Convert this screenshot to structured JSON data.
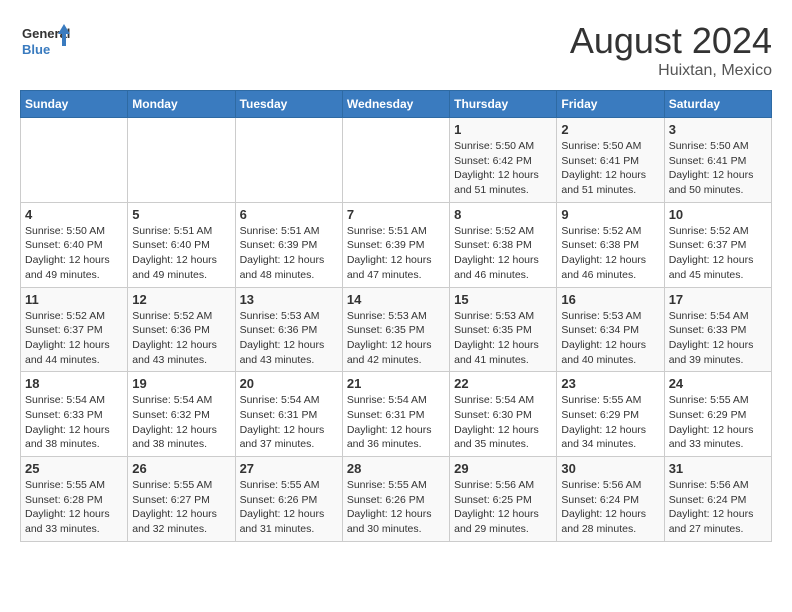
{
  "logo": {
    "line1": "General",
    "line2": "Blue"
  },
  "title": "August 2024",
  "subtitle": "Huixtan, Mexico",
  "days_header": [
    "Sunday",
    "Monday",
    "Tuesday",
    "Wednesday",
    "Thursday",
    "Friday",
    "Saturday"
  ],
  "weeks": [
    [
      {
        "num": "",
        "info": ""
      },
      {
        "num": "",
        "info": ""
      },
      {
        "num": "",
        "info": ""
      },
      {
        "num": "",
        "info": ""
      },
      {
        "num": "1",
        "info": "Sunrise: 5:50 AM\nSunset: 6:42 PM\nDaylight: 12 hours\nand 51 minutes."
      },
      {
        "num": "2",
        "info": "Sunrise: 5:50 AM\nSunset: 6:41 PM\nDaylight: 12 hours\nand 51 minutes."
      },
      {
        "num": "3",
        "info": "Sunrise: 5:50 AM\nSunset: 6:41 PM\nDaylight: 12 hours\nand 50 minutes."
      }
    ],
    [
      {
        "num": "4",
        "info": "Sunrise: 5:50 AM\nSunset: 6:40 PM\nDaylight: 12 hours\nand 49 minutes."
      },
      {
        "num": "5",
        "info": "Sunrise: 5:51 AM\nSunset: 6:40 PM\nDaylight: 12 hours\nand 49 minutes."
      },
      {
        "num": "6",
        "info": "Sunrise: 5:51 AM\nSunset: 6:39 PM\nDaylight: 12 hours\nand 48 minutes."
      },
      {
        "num": "7",
        "info": "Sunrise: 5:51 AM\nSunset: 6:39 PM\nDaylight: 12 hours\nand 47 minutes."
      },
      {
        "num": "8",
        "info": "Sunrise: 5:52 AM\nSunset: 6:38 PM\nDaylight: 12 hours\nand 46 minutes."
      },
      {
        "num": "9",
        "info": "Sunrise: 5:52 AM\nSunset: 6:38 PM\nDaylight: 12 hours\nand 46 minutes."
      },
      {
        "num": "10",
        "info": "Sunrise: 5:52 AM\nSunset: 6:37 PM\nDaylight: 12 hours\nand 45 minutes."
      }
    ],
    [
      {
        "num": "11",
        "info": "Sunrise: 5:52 AM\nSunset: 6:37 PM\nDaylight: 12 hours\nand 44 minutes."
      },
      {
        "num": "12",
        "info": "Sunrise: 5:52 AM\nSunset: 6:36 PM\nDaylight: 12 hours\nand 43 minutes."
      },
      {
        "num": "13",
        "info": "Sunrise: 5:53 AM\nSunset: 6:36 PM\nDaylight: 12 hours\nand 43 minutes."
      },
      {
        "num": "14",
        "info": "Sunrise: 5:53 AM\nSunset: 6:35 PM\nDaylight: 12 hours\nand 42 minutes."
      },
      {
        "num": "15",
        "info": "Sunrise: 5:53 AM\nSunset: 6:35 PM\nDaylight: 12 hours\nand 41 minutes."
      },
      {
        "num": "16",
        "info": "Sunrise: 5:53 AM\nSunset: 6:34 PM\nDaylight: 12 hours\nand 40 minutes."
      },
      {
        "num": "17",
        "info": "Sunrise: 5:54 AM\nSunset: 6:33 PM\nDaylight: 12 hours\nand 39 minutes."
      }
    ],
    [
      {
        "num": "18",
        "info": "Sunrise: 5:54 AM\nSunset: 6:33 PM\nDaylight: 12 hours\nand 38 minutes."
      },
      {
        "num": "19",
        "info": "Sunrise: 5:54 AM\nSunset: 6:32 PM\nDaylight: 12 hours\nand 38 minutes."
      },
      {
        "num": "20",
        "info": "Sunrise: 5:54 AM\nSunset: 6:31 PM\nDaylight: 12 hours\nand 37 minutes."
      },
      {
        "num": "21",
        "info": "Sunrise: 5:54 AM\nSunset: 6:31 PM\nDaylight: 12 hours\nand 36 minutes."
      },
      {
        "num": "22",
        "info": "Sunrise: 5:54 AM\nSunset: 6:30 PM\nDaylight: 12 hours\nand 35 minutes."
      },
      {
        "num": "23",
        "info": "Sunrise: 5:55 AM\nSunset: 6:29 PM\nDaylight: 12 hours\nand 34 minutes."
      },
      {
        "num": "24",
        "info": "Sunrise: 5:55 AM\nSunset: 6:29 PM\nDaylight: 12 hours\nand 33 minutes."
      }
    ],
    [
      {
        "num": "25",
        "info": "Sunrise: 5:55 AM\nSunset: 6:28 PM\nDaylight: 12 hours\nand 33 minutes."
      },
      {
        "num": "26",
        "info": "Sunrise: 5:55 AM\nSunset: 6:27 PM\nDaylight: 12 hours\nand 32 minutes."
      },
      {
        "num": "27",
        "info": "Sunrise: 5:55 AM\nSunset: 6:26 PM\nDaylight: 12 hours\nand 31 minutes."
      },
      {
        "num": "28",
        "info": "Sunrise: 5:55 AM\nSunset: 6:26 PM\nDaylight: 12 hours\nand 30 minutes."
      },
      {
        "num": "29",
        "info": "Sunrise: 5:56 AM\nSunset: 6:25 PM\nDaylight: 12 hours\nand 29 minutes."
      },
      {
        "num": "30",
        "info": "Sunrise: 5:56 AM\nSunset: 6:24 PM\nDaylight: 12 hours\nand 28 minutes."
      },
      {
        "num": "31",
        "info": "Sunrise: 5:56 AM\nSunset: 6:24 PM\nDaylight: 12 hours\nand 27 minutes."
      }
    ]
  ]
}
